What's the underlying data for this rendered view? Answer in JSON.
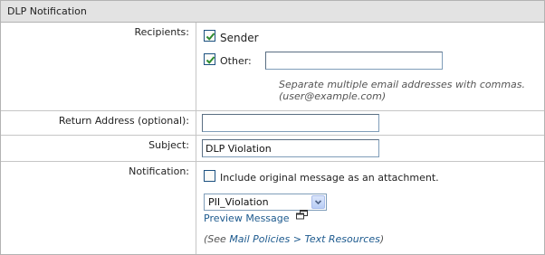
{
  "panel": {
    "title": "DLP Notification"
  },
  "recipients": {
    "label": "Recipients:",
    "sender_label": "Sender",
    "sender_checked": true,
    "other_label": "Other:",
    "other_checked": true,
    "other_value": "",
    "hint_line1": "Separate multiple email addresses with commas.",
    "hint_line2": "(user@example.com)"
  },
  "return_address": {
    "label": "Return Address (optional):",
    "value": ""
  },
  "subject": {
    "label": "Subject:",
    "value": "DLP Violation"
  },
  "notification": {
    "label": "Notification:",
    "include_label": "Include original message as an attachment.",
    "include_checked": false,
    "template_selected": "PII_Violation",
    "preview_label": "Preview Message",
    "see_prefix": "(See ",
    "mail_policies_link": "Mail Policies",
    "separator": " > ",
    "text_resources_link": "Text Resources",
    "see_suffix": ")"
  },
  "colors": {
    "check": "#2e8b2e",
    "link": "#1d5a8e",
    "header_bg": "#e3e3e3"
  },
  "icons": {
    "checkmark": "checkmark-icon",
    "new_window": "new-window-icon",
    "dropdown": "chevron-down-icon"
  }
}
